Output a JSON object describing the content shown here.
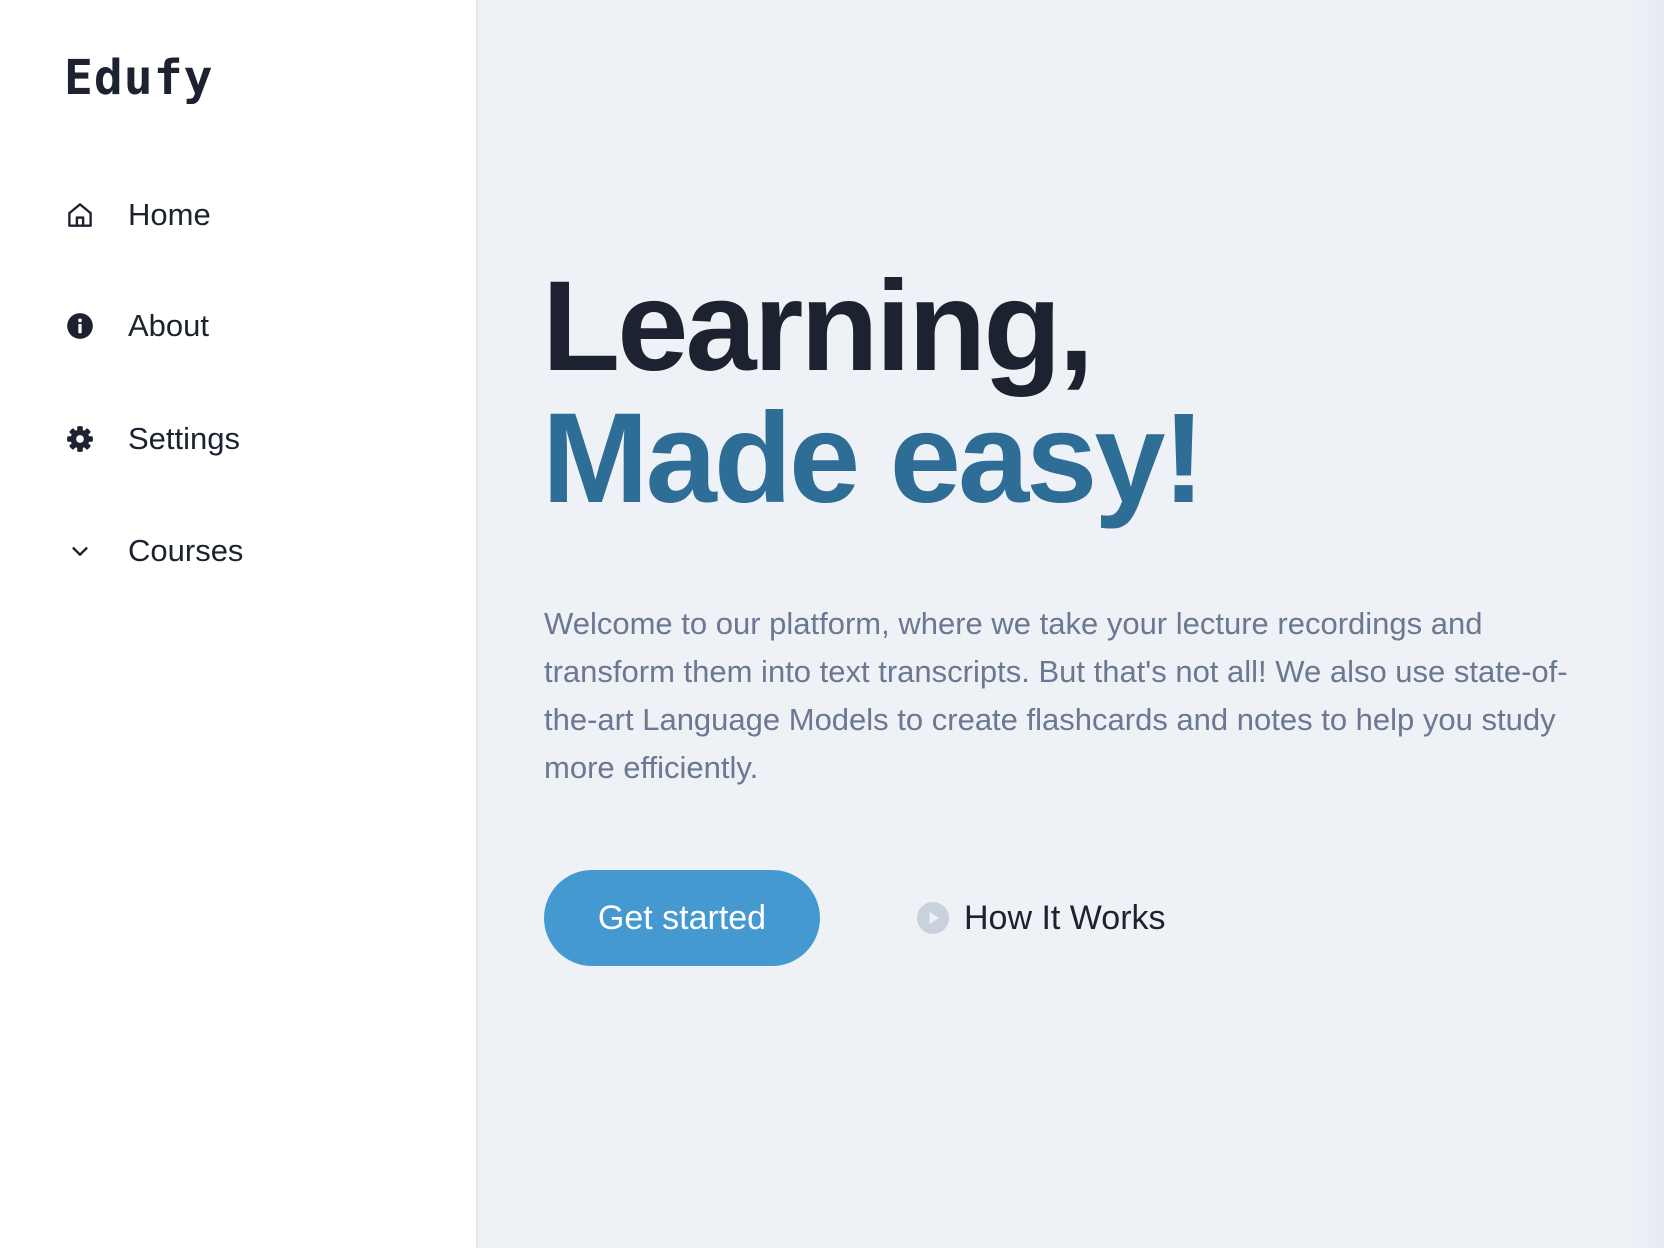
{
  "sidebar": {
    "logo": "Edufy",
    "items": [
      {
        "label": "Home",
        "icon": "home-icon"
      },
      {
        "label": "About",
        "icon": "info-icon"
      },
      {
        "label": "Settings",
        "icon": "gear-icon"
      },
      {
        "label": "Courses",
        "icon": "chevron-down-icon"
      }
    ]
  },
  "hero": {
    "headline_line1": "Learning,",
    "headline_line2": "Made easy!",
    "description": "Welcome to our platform, where we take your lecture recordings and transform them into text transcripts. But that's not all! We also use state-of-the-art Language Models to create flashcards and notes to help you study more efficiently.",
    "primary_button": "Get started",
    "secondary_button": "How It Works",
    "secondary_icon": "play-icon"
  },
  "colors": {
    "accent": "#2e6d96",
    "button": "#4499d1",
    "background": "#eef1f6",
    "text": "#1c2230",
    "muted_text": "#6b7891"
  }
}
